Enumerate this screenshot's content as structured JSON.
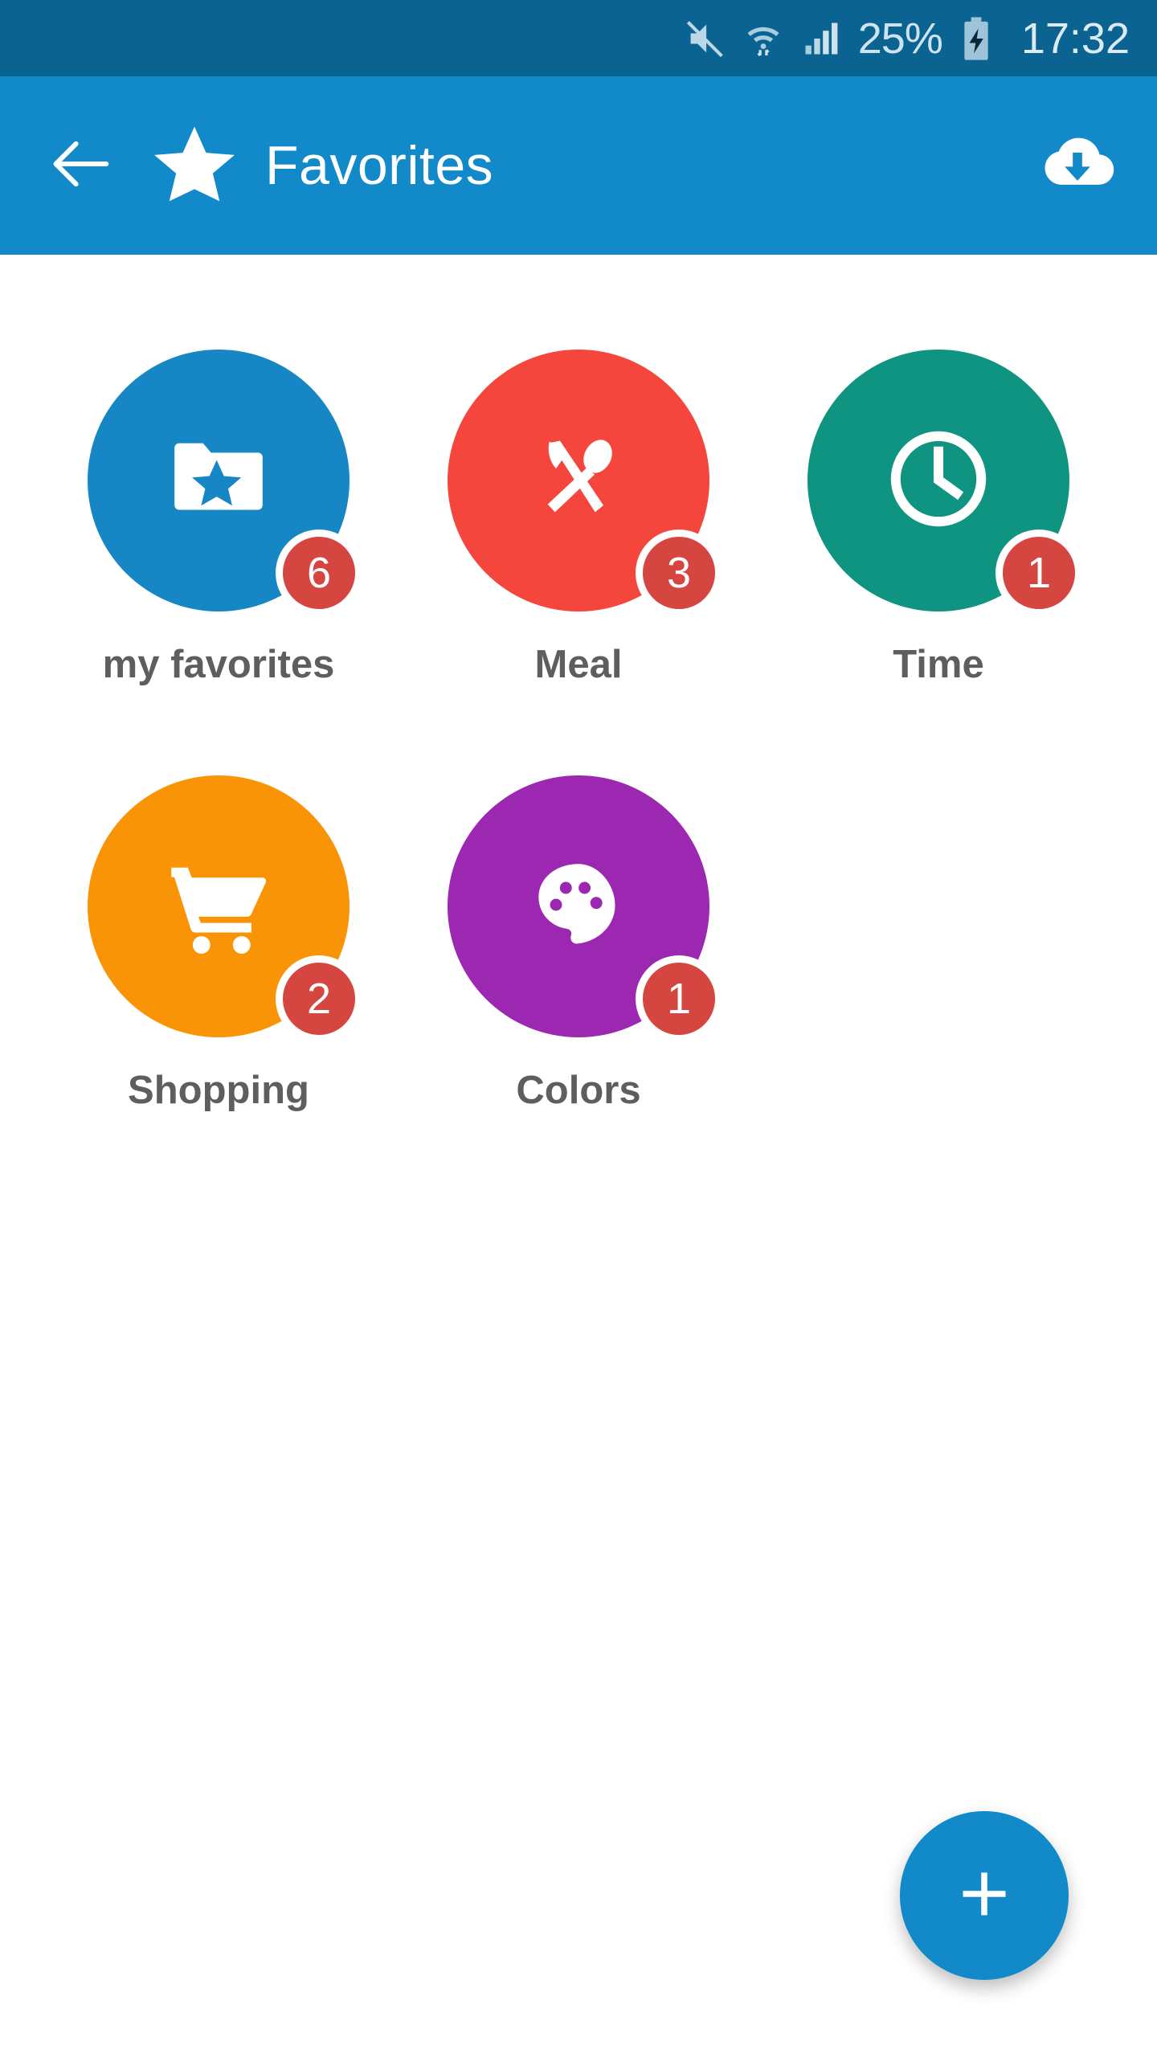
{
  "status_bar": {
    "background": "#0a6391",
    "battery_percent": "25%",
    "time": "17:32",
    "icons": [
      "mute-icon",
      "wifi-icon",
      "signal-icon",
      "battery-charging-icon"
    ]
  },
  "app_bar": {
    "background": "#1289c8",
    "title": "Favorites",
    "back_icon": "arrow-left-icon",
    "logo_icon": "star-icon",
    "action_icon": "cloud-download-icon"
  },
  "grid": {
    "items": [
      {
        "label": "my favorites",
        "badge": "6",
        "color": "#1687c4",
        "icon": "folder-star-icon"
      },
      {
        "label": "Meal",
        "badge": "3",
        "color": "#f4463c",
        "icon": "cutlery-icon"
      },
      {
        "label": "Time",
        "badge": "1",
        "color": "#0f9481",
        "icon": "clock-icon"
      },
      {
        "label": "Shopping",
        "badge": "2",
        "color": "#f99406",
        "icon": "shopping-cart-icon"
      },
      {
        "label": "Colors",
        "badge": "1",
        "color": "#9c27b0",
        "icon": "palette-icon"
      }
    ],
    "badge_color": "#d64641",
    "label_color": "#5e5e5e"
  },
  "fab": {
    "icon": "plus-icon",
    "color": "#1289c8"
  }
}
